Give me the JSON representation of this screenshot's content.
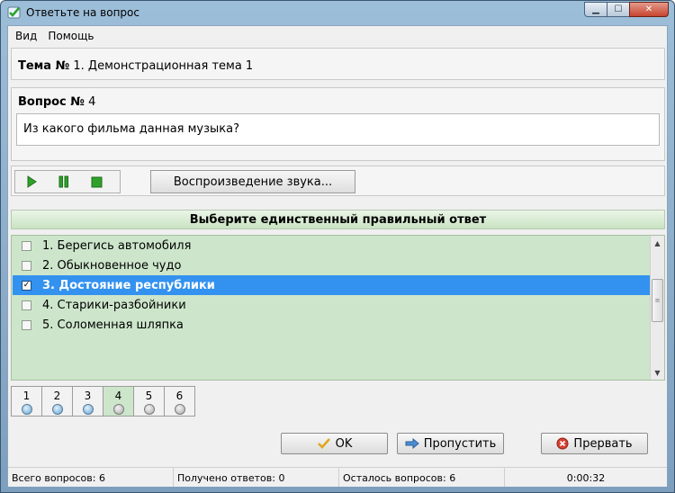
{
  "window": {
    "title": "Ответьте на вопрос",
    "icon": "check-icon",
    "buttons": [
      "minimize-icon",
      "maximize-icon",
      "close-icon"
    ]
  },
  "menu": [
    "Вид",
    "Помощь"
  ],
  "theme": {
    "label": "Тема №",
    "value": "1. Демонстрационная тема 1"
  },
  "question": {
    "label": "Вопрос №",
    "number": "4",
    "text": "Из какого фильма данная музыка?"
  },
  "media": {
    "controls": [
      "play-icon",
      "pause-icon",
      "stop-icon"
    ],
    "sound_button": "Воспроизведение звука..."
  },
  "answers": {
    "header": "Выберите единственный правильный ответ",
    "items": [
      {
        "label": "1. Берегись автомобиля",
        "checked": false
      },
      {
        "label": "2. Обыкновенное чудо",
        "checked": false
      },
      {
        "label": "3. Достояние республики",
        "checked": true
      },
      {
        "label": "4. Старики-разбойники",
        "checked": false
      },
      {
        "label": "5. Соломенная шляпка",
        "checked": false
      }
    ],
    "selected_index": 2
  },
  "navigation": {
    "questions": [
      {
        "number": "1",
        "status": "answered"
      },
      {
        "number": "2",
        "status": "answered"
      },
      {
        "number": "3",
        "status": "answered"
      },
      {
        "number": "4",
        "status": "current"
      },
      {
        "number": "5",
        "status": "pending"
      },
      {
        "number": "6",
        "status": "pending"
      }
    ]
  },
  "buttons": {
    "ok": "OK",
    "skip": "Пропустить",
    "abort": "Прервать"
  },
  "status": {
    "total": "Всего вопросов: 6",
    "answered": "Получено ответов: 0",
    "remaining": "Осталось вопросов: 6",
    "time": "0:00:32"
  },
  "colors": {
    "selection": "#3392ef",
    "answers_background": "#cde6cb",
    "play_green": "#2fa12b"
  }
}
